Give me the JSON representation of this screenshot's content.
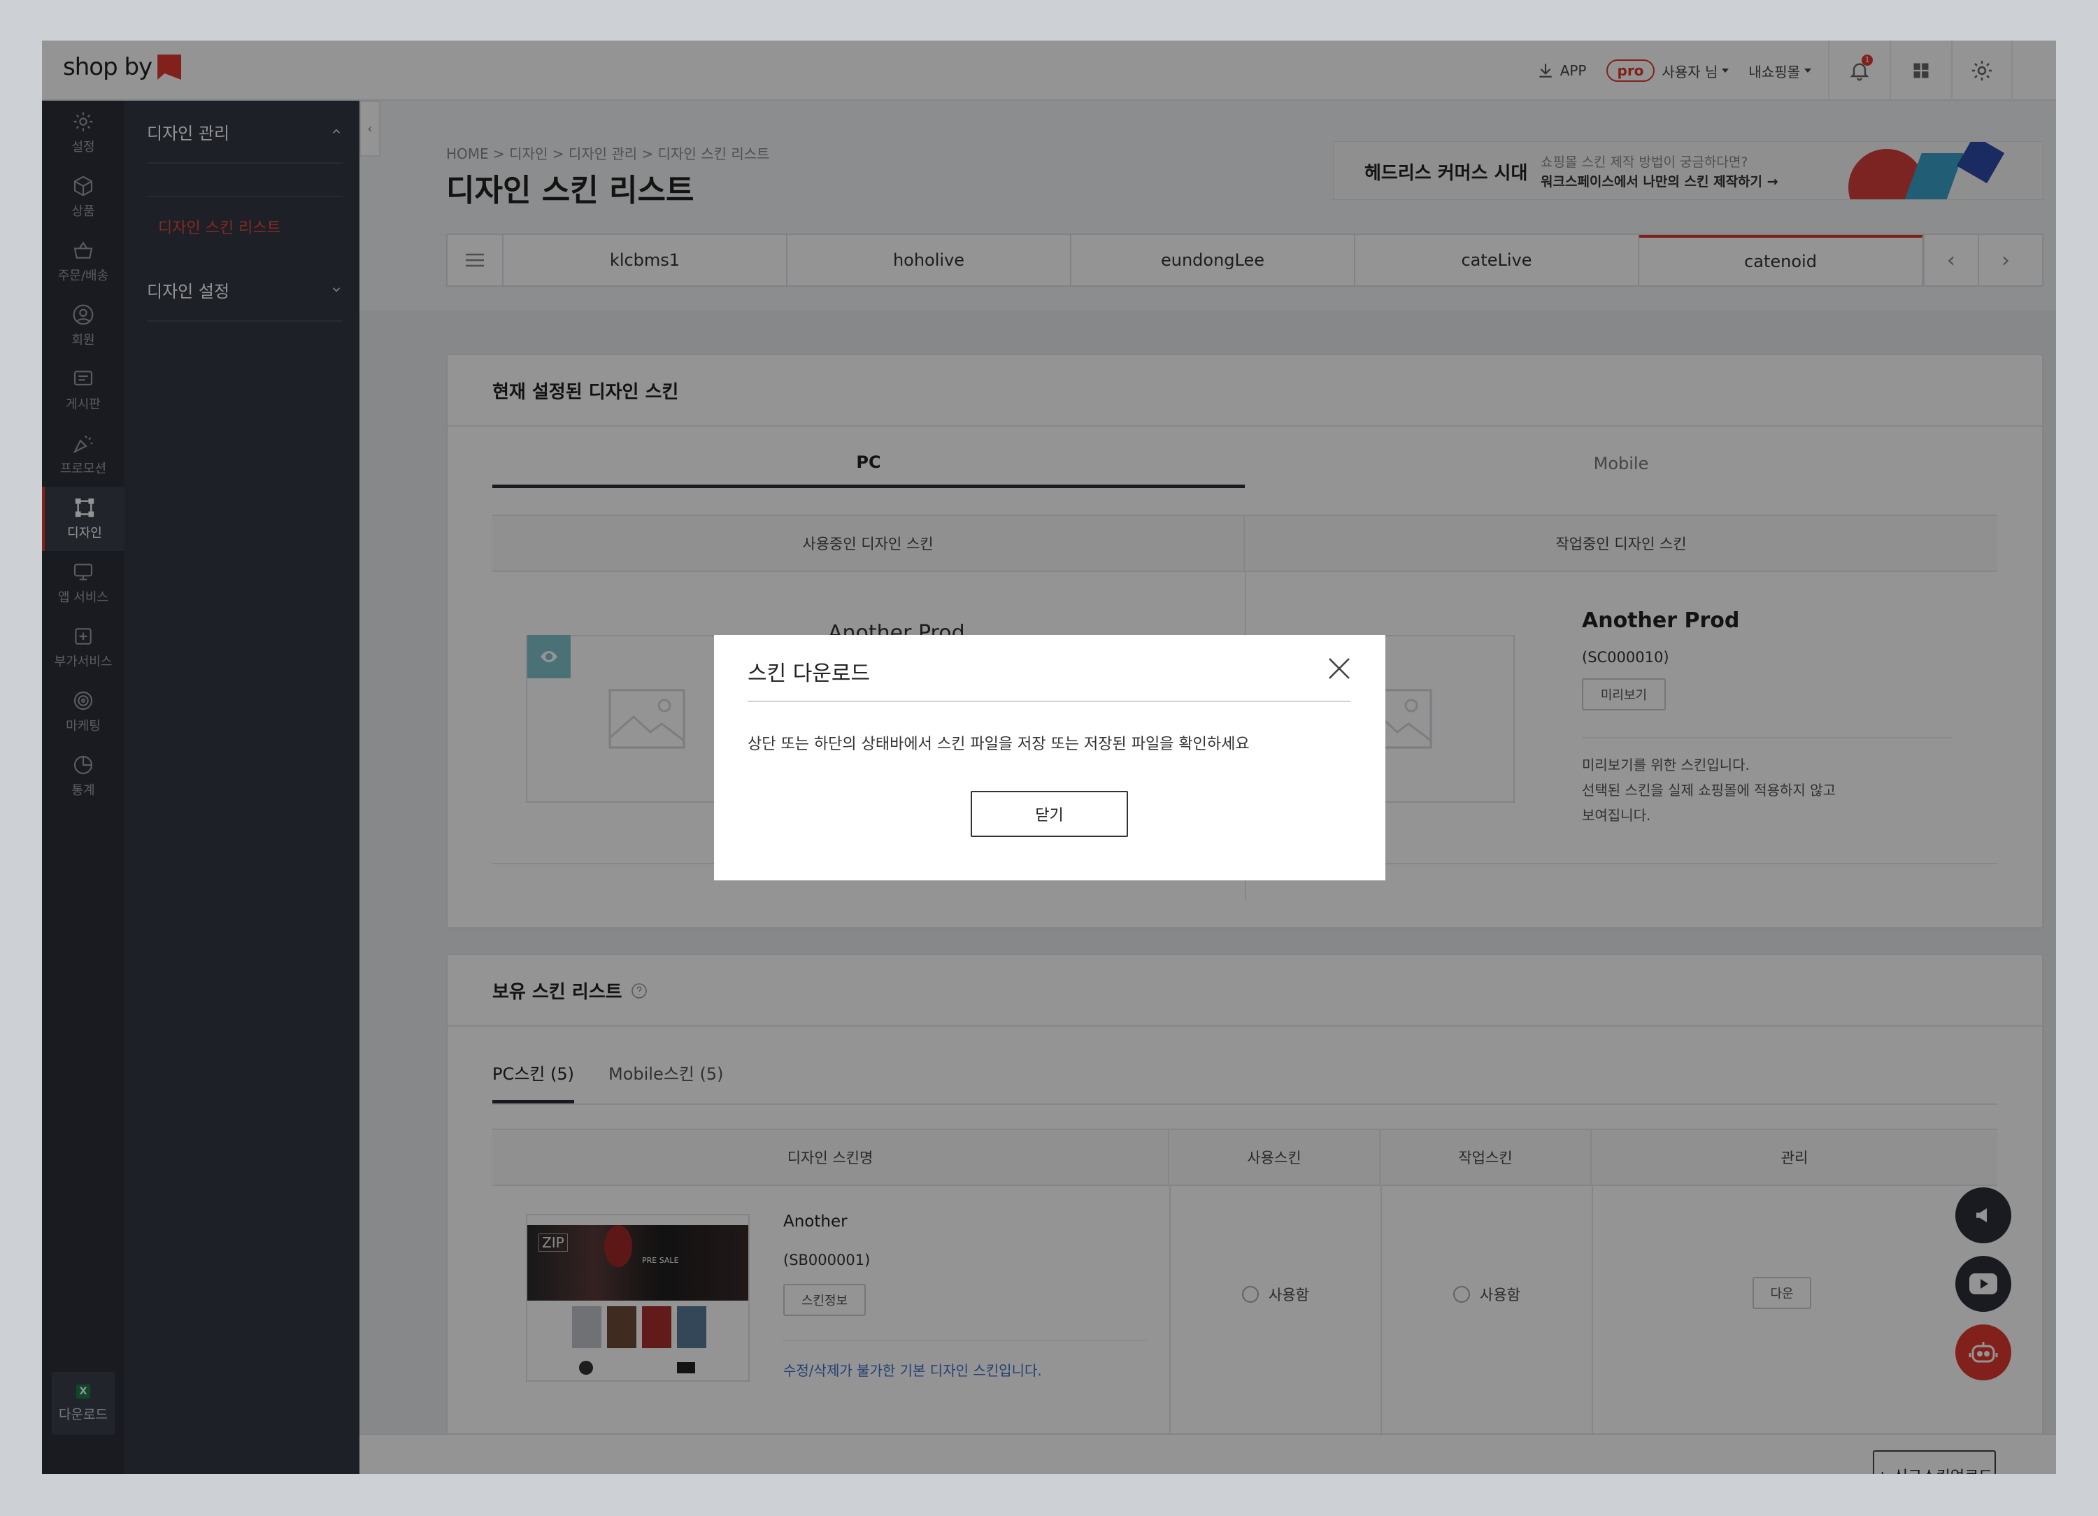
{
  "header": {
    "logo_text": "shop by",
    "app_label": "APP",
    "pro_badge": "pro",
    "user_label": "사용자 님",
    "myshop_label": "내쇼핑몰",
    "notification_count": "1",
    "brand_color": "#e03a2f"
  },
  "rail": {
    "items": [
      {
        "label": "설정",
        "icon": "gear-icon"
      },
      {
        "label": "상품",
        "icon": "box-icon"
      },
      {
        "label": "주문/배송",
        "icon": "basket-icon"
      },
      {
        "label": "회원",
        "icon": "user-icon"
      },
      {
        "label": "게시판",
        "icon": "board-icon"
      },
      {
        "label": "프로모션",
        "icon": "promotion-icon"
      },
      {
        "label": "디자인",
        "icon": "design-icon"
      },
      {
        "label": "앱 서비스",
        "icon": "app-service-icon"
      },
      {
        "label": "부가서비스",
        "icon": "addon-icon"
      },
      {
        "label": "마케팅",
        "icon": "target-icon"
      },
      {
        "label": "통계",
        "icon": "pie-chart-icon"
      }
    ],
    "download_badge": "X",
    "download_label": "다운로드"
  },
  "submenu": {
    "section1": "디자인 관리",
    "section1_item": "디자인 스킨 리스트",
    "section2": "디자인 설정"
  },
  "page": {
    "breadcrumb": "HOME > 디자인 > 디자인 관리 > 디자인 스킨 리스트",
    "title": "디자인 스킨 리스트"
  },
  "banner": {
    "title": "헤드리스 커머스 시대",
    "line1": "쇼핑몰 스킨 제작 방법이 궁금하다면?",
    "line2": "워크스페이스에서 나만의 스킨 제작하기 →"
  },
  "shop_tabs": [
    "klcbms1",
    "hoholive",
    "eundongLee",
    "cateLive",
    "catenoid"
  ],
  "current_skin": {
    "heading": "현재 설정된 디자인 스킨",
    "tab_pc": "PC",
    "tab_mobile": "Mobile",
    "col_using": "사용중인 디자인 스킨",
    "col_working": "작업중인 디자인 스킨",
    "using_name_partial": "Another Prod",
    "working_name": "Another Prod",
    "working_code": "(SC000010)",
    "preview_btn": "미리보기",
    "desc_line1": "미리보기를 위한 스킨입니다.",
    "desc_line2": "선택된 스킨을 실제 쇼핑몰에 적용하지 않고",
    "desc_line3": "보여집니다."
  },
  "owned_skins": {
    "heading": "보유 스킨 리스트",
    "tab_pc": "PC스킨 (5)",
    "tab_mobile": "Mobile스킨 (5)",
    "columns": [
      "디자인 스킨명",
      "사용스킨",
      "작업스킨",
      "관리"
    ],
    "row": {
      "thumb_badge": "ZIP",
      "thumb_text": "PRE SALE",
      "name": "Another",
      "code": "(SB000001)",
      "info_btn": "스킨정보",
      "note": "수정/삭제가 불가한 기본 디자인 스킨입니다.",
      "use_label": "사용함",
      "work_label": "사용함",
      "manage_btn": "다운"
    }
  },
  "footer": {
    "upload_btn": "+ 신규스킨업로드"
  },
  "modal": {
    "title": "스킨 다운로드",
    "message": "상단 또는 하단의 상태바에서 스킨 파일을 저장 또는 저장된 파일을 확인하세요",
    "close_btn": "닫기"
  }
}
